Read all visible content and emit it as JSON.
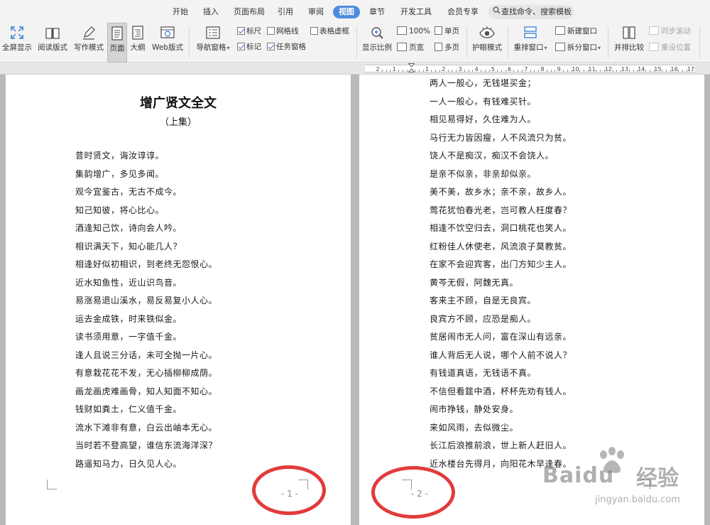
{
  "menu": {
    "tabs": [
      {
        "label": "开始",
        "active": false
      },
      {
        "label": "插入",
        "active": false
      },
      {
        "label": "页面布局",
        "active": false
      },
      {
        "label": "引用",
        "active": false
      },
      {
        "label": "审阅",
        "active": false
      },
      {
        "label": "视图",
        "active": true
      },
      {
        "label": "章节",
        "active": false
      },
      {
        "label": "开发工具",
        "active": false
      },
      {
        "label": "会员专享",
        "active": false
      }
    ],
    "search_label": "查找命令、搜索模板"
  },
  "ribbon": {
    "fullscreen": "全屏显示",
    "reading_layout": "阅读版式",
    "writing_mode": "写作模式",
    "page_view": "页面",
    "outline_view": "大纲",
    "web_layout": "Web版式",
    "nav_pane": "导航窗格",
    "chk_ruler": "标尺",
    "chk_gridlines": "网格线",
    "chk_table_gridlines": "表格虚框",
    "chk_markup": "标记",
    "chk_task_pane": "任务窗格",
    "zoom": "显示比例",
    "zoom_100": "100%",
    "page_width": "页宽",
    "single_page": "单页",
    "multi_page": "多页",
    "eye_protect": "护眼模式",
    "arrange_windows": "重排窗口",
    "new_window": "新建窗口",
    "split_window": "拆分窗口",
    "side_by_side": "并排比较",
    "sync_scroll": "同步滚动",
    "reset_position": "重设位置",
    "checkbox_state": {
      "ruler": true,
      "gridlines": false,
      "table_gridlines": false,
      "markup": true,
      "task_pane": true
    }
  },
  "ruler": {
    "numbers": [
      "2",
      "1",
      "",
      "1",
      "2",
      "3",
      "4",
      "5",
      "6",
      "7",
      "8",
      "9",
      "10",
      "11",
      "12",
      "13",
      "14",
      "15",
      "16",
      "17"
    ]
  },
  "page1": {
    "title": "增广贤文全文",
    "subtitle": "（上集）",
    "lines": [
      "昔时贤文，诲汝谆谆。",
      "集韵增广，多见多闻。",
      "观今宜鉴古，无古不成今。",
      "知己知彼，将心比心。",
      "酒逢知己饮，诗向会人吟。",
      "相识满天下，知心能几人？",
      "相逢好似初相识，到老终无怨恨心。",
      "近水知鱼性，近山识鸟音。",
      "易涨易退山溪水，易反易复小人心。",
      "运去金成铁，时来铁似金。",
      "读书须用意，一字值千金。",
      "逢人且说三分话，未可全抛一片心。",
      "有意栽花花不发，无心插柳柳成荫。",
      "画龙画虎难画骨，知人知面不知心。",
      "钱财如粪土，仁义值千金。",
      "流水下滩非有意，白云出岫本无心。",
      "当时若不登高望，谁信东流海洋深？",
      "路遥知马力，日久见人心。"
    ],
    "page_number": "- 1 -"
  },
  "page2": {
    "lines": [
      "两人一般心，无钱堪买金；",
      "一人一般心，有钱难买针。",
      "相见易得好，久住难为人。",
      "马行无力皆因瘦，人不风流只为贫。",
      "饶人不是痴汉，痴汉不会饶人。",
      "是亲不似亲，非亲却似亲。",
      "美不美，故乡水；亲不亲，故乡人。",
      "莺花犹怕春光老，岂可教人枉度春？",
      "相逢不饮空归去，洞口桃花也笑人。",
      "红粉佳人休使老，风流浪子莫教贫。",
      "在家不会迎宾客，出门方知少主人。",
      "黄芩无假，阿魏无真。",
      "客来主不顾，自是无良宾。",
      "良宾方不顾，应恐是痴人。",
      "贫居闹市无人问，富在深山有远亲。",
      "谁人背后无人说，哪个人前不说人？",
      "有钱道真语，无钱语不真。",
      "不信但看筵中酒，杯杯先劝有钱人。",
      "闹市挣钱，静处安身。",
      "来如风雨，去似微尘。",
      "长江后浪推前浪，世上新人赶旧人。",
      "近水楼台先得月，向阳花木早逢春。"
    ],
    "page_number": "- 2 -"
  },
  "watermark": {
    "brand": "Baidu",
    "brand_cn": "经验",
    "url": "jingyan.baidu.com"
  },
  "colors": {
    "active_tab": "#4e8bdf",
    "highlight_circle": "#e23b3b",
    "checkbox_check": "#3b6fd1",
    "workspace_bg": "#b9b9b9"
  }
}
